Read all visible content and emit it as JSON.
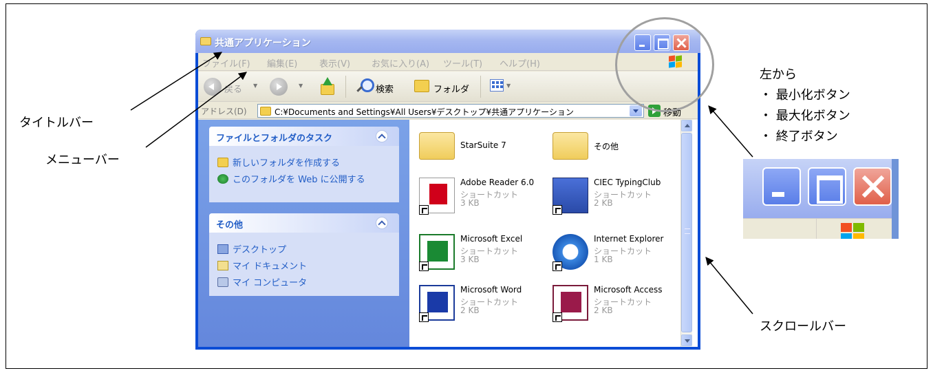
{
  "window": {
    "title": "共通アプリケーション",
    "menu": [
      "ファイル(F)",
      "編集(E)",
      "表示(V)",
      "お気に入り(A)",
      "ツール(T)",
      "ヘルプ(H)"
    ],
    "toolbar": {
      "back_label": "戻る",
      "search_label": "検索",
      "folders_label": "フォルダ"
    },
    "address": {
      "label": "アドレス(D)",
      "value": "C:¥Documents and Settings¥All Users¥デスクトップ¥共通アプリケーション",
      "go_label": "移動"
    },
    "taskpane": {
      "tasks": {
        "title": "ファイルとフォルダのタスク",
        "links": [
          "新しいフォルダを作成する",
          "このフォルダを Web に公開する"
        ]
      },
      "other": {
        "title": "その他",
        "links": [
          "デスクトップ",
          "マイ ドキュメント",
          "マイ コンピュータ"
        ]
      }
    },
    "files": [
      {
        "name": "StarSuite 7",
        "type": "",
        "size": "",
        "icon": "folder-icon"
      },
      {
        "name": "その他",
        "type": "",
        "size": "",
        "icon": "folder-icon"
      },
      {
        "name": "Adobe Reader 6.0",
        "type": "ショートカット",
        "size": "3 KB",
        "icon": "adobe-reader-icon"
      },
      {
        "name": "CIEC TypingClub",
        "type": "ショートカット",
        "size": "2 KB",
        "icon": "typing-icon"
      },
      {
        "name": "Microsoft Excel",
        "type": "ショートカット",
        "size": "3 KB",
        "icon": "excel-icon"
      },
      {
        "name": "Internet Explorer",
        "type": "ショートカット",
        "size": "1 KB",
        "icon": "ie-icon"
      },
      {
        "name": "Microsoft Word",
        "type": "ショートカット",
        "size": "2 KB",
        "icon": "word-icon"
      },
      {
        "name": "Microsoft Access",
        "type": "ショートカット",
        "size": "2 KB",
        "icon": "access-icon"
      }
    ]
  },
  "annotations": {
    "title_bar": "タイトルバー",
    "menu_bar": "メニューバー",
    "scroll_bar": "スクロールバー",
    "buttons_heading": "左から",
    "buttons": [
      "・ 最小化ボタン",
      "・ 最大化ボタン",
      "・ 終了ボタン"
    ]
  },
  "colors": {
    "title_bar_inactive": "#98acee",
    "task_pane": "#6487dc",
    "link": "#215dc6",
    "close_button": "#e0604a"
  }
}
